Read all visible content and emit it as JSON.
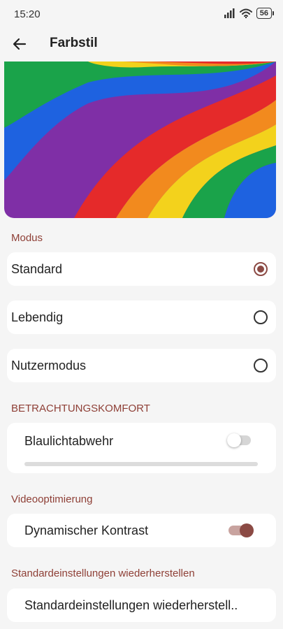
{
  "status": {
    "time": "15:20",
    "battery": "56"
  },
  "header": {
    "title": "Farbstil"
  },
  "sections": {
    "mode": "Modus",
    "comfort": "BETRACHTUNGSKOMFORT",
    "video": "Videooptimierung",
    "reset": "Standardeinstellungen wiederherstellen"
  },
  "modes": [
    {
      "label": "Standard",
      "selected": true
    },
    {
      "label": "Lebendig",
      "selected": false
    },
    {
      "label": "Nutzermodus",
      "selected": false
    }
  ],
  "comfort": {
    "blue_light_label": "Blaulichtabwehr",
    "enabled": false,
    "level": 0
  },
  "video": {
    "dynamic_contrast_label": "Dynamischer Kontrast",
    "enabled": true
  },
  "reset": {
    "button_label": "Standardeinstellungen wiederherstell.."
  },
  "colors": {
    "accent": "#8b4a44",
    "section_label": "#8e3f36",
    "background": "#f5f5f5",
    "card": "#ffffff"
  }
}
